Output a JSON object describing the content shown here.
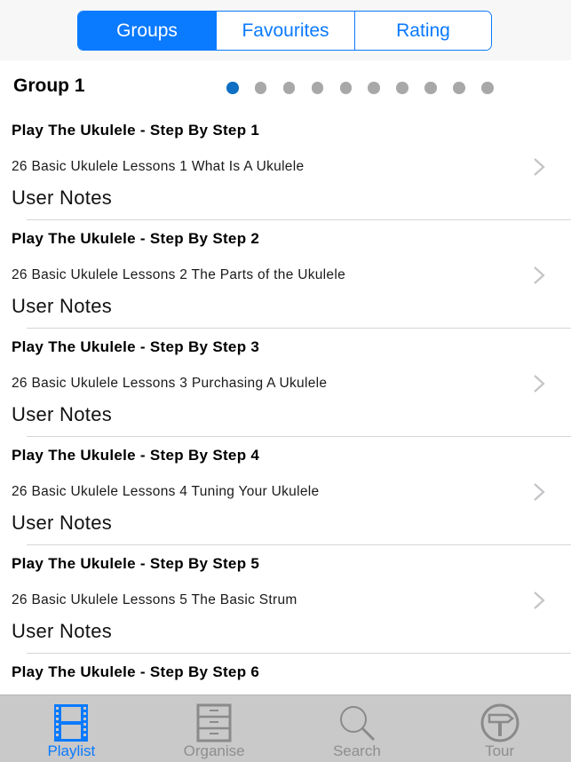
{
  "segmented_control": {
    "options": [
      {
        "label": "Groups",
        "active": true
      },
      {
        "label": "Favourites",
        "active": false
      },
      {
        "label": "Rating",
        "active": false
      }
    ]
  },
  "group": {
    "title": "Group 1",
    "page_count": 10,
    "current_page": 1
  },
  "playlist": {
    "items": [
      {
        "title": "Play The Ukulele - Step By Step 1",
        "subtitle": "26 Basic Ukulele Lessons 1 What Is A Ukulele",
        "notes": "User Notes"
      },
      {
        "title": "Play The Ukulele - Step By Step 2",
        "subtitle": "26 Basic Ukulele Lessons 2 The Parts of the Ukulele",
        "notes": "User Notes"
      },
      {
        "title": "Play The Ukulele - Step By Step 3",
        "subtitle": "26 Basic Ukulele Lessons 3 Purchasing A Ukulele",
        "notes": "User Notes"
      },
      {
        "title": "Play The Ukulele - Step By Step 4",
        "subtitle": "26 Basic Ukulele Lessons 4 Tuning Your Ukulele",
        "notes": "User Notes"
      },
      {
        "title": "Play The Ukulele - Step By Step 5",
        "subtitle": "26 Basic Ukulele Lessons 5 The Basic Strum",
        "notes": "User Notes"
      },
      {
        "title": "Play The Ukulele - Step By Step 6",
        "subtitle": "",
        "notes": ""
      }
    ]
  },
  "tab_bar": {
    "tabs": [
      {
        "label": "Playlist",
        "icon": "film-strip-icon",
        "active": true
      },
      {
        "label": "Organise",
        "icon": "file-cabinet-icon",
        "active": false
      },
      {
        "label": "Search",
        "icon": "magnifier-icon",
        "active": false
      },
      {
        "label": "Tour",
        "icon": "signpost-icon",
        "active": false
      }
    ]
  },
  "colors": {
    "accent": "#0a7aff",
    "active_dot": "#0e6fc3",
    "inactive_dot": "#a8a8a8",
    "tab_bar_bg": "#c9c9c9",
    "inactive_tab": "#8e8e8e"
  }
}
